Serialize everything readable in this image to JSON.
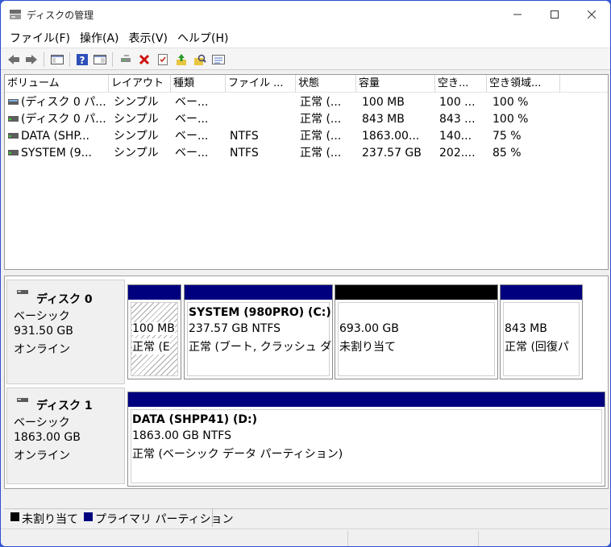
{
  "window": {
    "title": "ディスクの管理",
    "min_icon": "minimize-icon",
    "max_icon": "maximize-icon",
    "close_icon": "close-icon"
  },
  "menu": [
    {
      "label": "ファイル(F)"
    },
    {
      "label": "操作(A)"
    },
    {
      "label": "表示(V)"
    },
    {
      "label": "ヘルプ(H)"
    }
  ],
  "toolbar": [
    {
      "icon": "back-arrow-icon"
    },
    {
      "icon": "forward-arrow-icon"
    },
    {
      "icon": "console-tree-icon"
    },
    {
      "icon": "help-icon"
    },
    {
      "icon": "show-hide-pane-icon"
    },
    {
      "icon": "connect-icon"
    },
    {
      "icon": "delete-icon"
    },
    {
      "icon": "properties-icon"
    },
    {
      "icon": "export-icon"
    },
    {
      "icon": "search-icon"
    },
    {
      "icon": "settings-list-icon"
    }
  ],
  "volumes": {
    "columns": [
      "ボリューム",
      "レイアウト",
      "種類",
      "ファイル ...",
      "状態",
      "容量",
      "空き...",
      "空き領域..."
    ],
    "rows": [
      {
        "volume": "(ディスク 0 パ...",
        "layout": "シンプル",
        "type": "ベー...",
        "fs": "",
        "status": "正常 (...",
        "capacity": "100 MB",
        "free": "100 ...",
        "free_pct": "100 %"
      },
      {
        "volume": "(ディスク 0 パ...",
        "layout": "シンプル",
        "type": "ベー...",
        "fs": "",
        "status": "正常 (...",
        "capacity": "843 MB",
        "free": "843 ...",
        "free_pct": "100 %"
      },
      {
        "volume": "DATA (SHP...",
        "layout": "シンプル",
        "type": "ベー...",
        "fs": "NTFS",
        "status": "正常 (...",
        "capacity": "1863.00...",
        "free": "140...",
        "free_pct": "75 %"
      },
      {
        "volume": "SYSTEM (9...",
        "layout": "シンプル",
        "type": "ベー...",
        "fs": "NTFS",
        "status": "正常 (...",
        "capacity": "237.57 GB",
        "free": "202....",
        "free_pct": "85 %"
      }
    ]
  },
  "disks": [
    {
      "name": "ディスク 0",
      "kind": "ベーシック",
      "size": "931.50 GB",
      "state": "オンライン",
      "partitions": [
        {
          "line1": "100 MB",
          "line2": "正常 (E",
          "bold": ""
        },
        {
          "bold": "SYSTEM (980PRO)  (C:)",
          "line1": "237.57 GB NTFS",
          "line2": "正常 (ブート, クラッシュ ダンプ"
        },
        {
          "line1": "693.00 GB",
          "line2": "未割り当て",
          "bold": ""
        },
        {
          "line1": "843 MB",
          "line2": "正常 (回復パ",
          "bold": ""
        }
      ]
    },
    {
      "name": "ディスク 1",
      "kind": "ベーシック",
      "size": "1863.00 GB",
      "state": "オンライン",
      "partitions": [
        {
          "bold": "DATA (SHPP41)  (D:)",
          "line1": "1863.00 GB NTFS",
          "line2": "正常 (ベーシック データ パーティション)"
        }
      ]
    }
  ],
  "legend": [
    {
      "label": "未割り当て",
      "color": "#000000"
    },
    {
      "label": "プライマリ パーティション",
      "color": "#00007f"
    }
  ],
  "colors": {
    "primary": "#00007f",
    "unallocated": "#000000"
  }
}
